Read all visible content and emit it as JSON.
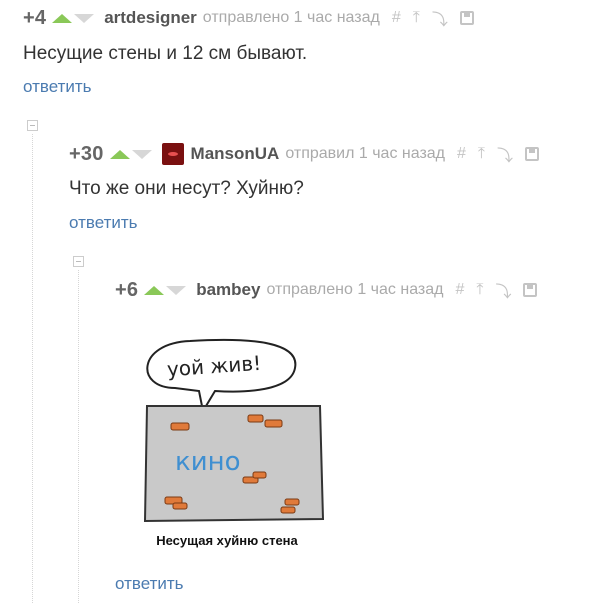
{
  "comments": [
    {
      "rating": "+4",
      "author": "artdesigner",
      "action": "отправлено 1 час назад",
      "text": "Несущие стены и 12 см бывают.",
      "reply_label": "ответить"
    },
    {
      "rating": "+30",
      "author": "MansonUA",
      "action": "отправил 1 час назад",
      "text": "Что же они несут? Хуйню?",
      "reply_label": "ответить"
    },
    {
      "rating": "+6",
      "author": "bambey",
      "action": "отправлено 1 час назад",
      "reply_label": "ответить",
      "image": {
        "bubble_text": "уой жив!",
        "wall_text": "кино",
        "caption": "Несущая хуйню стена",
        "wall_color": "#c9c9c9",
        "brick_color": "#e07a3a"
      }
    }
  ],
  "tools": {
    "link_icon": "#",
    "parent_icon": "⤒",
    "tree_icon": "⤵",
    "save_icon": "floppy-disk"
  },
  "colors": {
    "upvote": "#8ac858",
    "downvote": "#d7d7d7",
    "reply_link": "#4b7bb0"
  }
}
